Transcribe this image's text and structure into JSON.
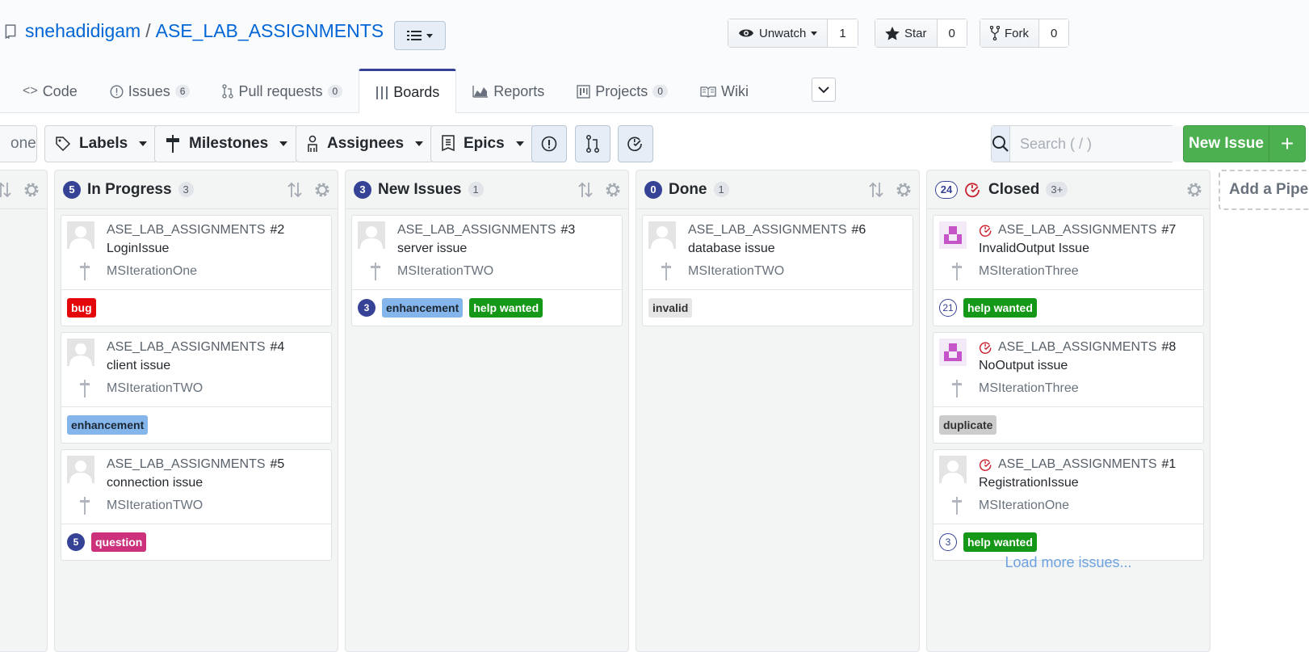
{
  "repo": {
    "owner": "snehadidigam",
    "separator": "/",
    "name": "ASE_LAB_ASSIGNMENTS"
  },
  "actions": {
    "watch": {
      "label": "Unwatch",
      "count": "1"
    },
    "star": {
      "label": "Star",
      "count": "0"
    },
    "fork": {
      "label": "Fork",
      "count": "0"
    }
  },
  "tabs": [
    {
      "label": "Code",
      "icon": "code-icon"
    },
    {
      "label": "Issues",
      "count": "6",
      "icon": "issue-icon"
    },
    {
      "label": "Pull requests",
      "count": "0",
      "icon": "pull-request-icon"
    },
    {
      "label": "Boards",
      "icon": "boards-icon",
      "active": true
    },
    {
      "label": "Reports",
      "icon": "graph-icon"
    },
    {
      "label": "Projects",
      "count": "0",
      "icon": "project-icon"
    },
    {
      "label": "Wiki",
      "icon": "book-icon"
    }
  ],
  "filters": {
    "first_partial": "one",
    "labels": "Labels",
    "milestones": "Milestones",
    "assignees": "Assignees",
    "epics": "Epics"
  },
  "search": {
    "placeholder": "Search ( / )"
  },
  "new_issue": {
    "label": "New Issue",
    "plus": "+"
  },
  "pipelines": [
    {
      "estimate": "5",
      "title": "In Progress",
      "count": "3",
      "cards": [
        {
          "repo": "ASE_LAB_ASSIGNMENTS",
          "number": "#2",
          "title": "LoginIssue",
          "milestone": "MSIterationOne",
          "estimate": "",
          "labels": [
            {
              "text": "bug",
              "bg": "#e4080a",
              "fg": "#ffffff"
            }
          ]
        },
        {
          "repo": "ASE_LAB_ASSIGNMENTS",
          "number": "#4",
          "title": "client issue",
          "milestone": "MSIterationTWO",
          "estimate": "",
          "labels": [
            {
              "text": "enhancement",
              "bg": "#84b6eb",
              "fg": "#1c2733"
            }
          ]
        },
        {
          "repo": "ASE_LAB_ASSIGNMENTS",
          "number": "#5",
          "title": "connection issue",
          "milestone": "MSIterationTWO",
          "estimate": "5",
          "labels": [
            {
              "text": "question",
              "bg": "#cc317c",
              "fg": "#ffffff"
            }
          ]
        }
      ]
    },
    {
      "estimate": "3",
      "title": "New Issues",
      "count": "1",
      "cards": [
        {
          "repo": "ASE_LAB_ASSIGNMENTS",
          "number": "#3",
          "title": "server issue",
          "milestone": "MSIterationTWO",
          "estimate": "3",
          "labels": [
            {
              "text": "enhancement",
              "bg": "#84b6eb",
              "fg": "#1c2733"
            },
            {
              "text": "help wanted",
              "bg": "#159818",
              "fg": "#ffffff"
            }
          ]
        }
      ]
    },
    {
      "estimate": "0",
      "title": "Done",
      "count": "1",
      "cards": [
        {
          "repo": "ASE_LAB_ASSIGNMENTS",
          "number": "#6",
          "title": "database issue",
          "milestone": "MSIterationTWO",
          "estimate": "",
          "labels": [
            {
              "text": "invalid",
              "bg": "#e6e6e6",
              "fg": "#333333"
            }
          ]
        }
      ]
    },
    {
      "estimate": "24",
      "title": "Closed",
      "count": "3+",
      "cards": [
        {
          "repo": "ASE_LAB_ASSIGNMENTS",
          "number": "#7",
          "title": "InvalidOutput Issue",
          "milestone": "MSIterationThree",
          "estimate": "21",
          "labels": [
            {
              "text": "help wanted",
              "bg": "#159818",
              "fg": "#ffffff"
            }
          ]
        },
        {
          "repo": "ASE_LAB_ASSIGNMENTS",
          "number": "#8",
          "title": "NoOutput issue",
          "milestone": "MSIterationThree",
          "estimate": "",
          "labels": [
            {
              "text": "duplicate",
              "bg": "#cccccc",
              "fg": "#333333"
            }
          ]
        },
        {
          "repo": "ASE_LAB_ASSIGNMENTS",
          "number": "#1",
          "title": "RegistrationIssue",
          "milestone": "MSIterationOne",
          "estimate": "3",
          "labels": [
            {
              "text": "help wanted",
              "bg": "#159818",
              "fg": "#ffffff"
            }
          ]
        }
      ],
      "load_more": "Load more issues..."
    }
  ],
  "add_pipeline": "Add a Pipeline"
}
